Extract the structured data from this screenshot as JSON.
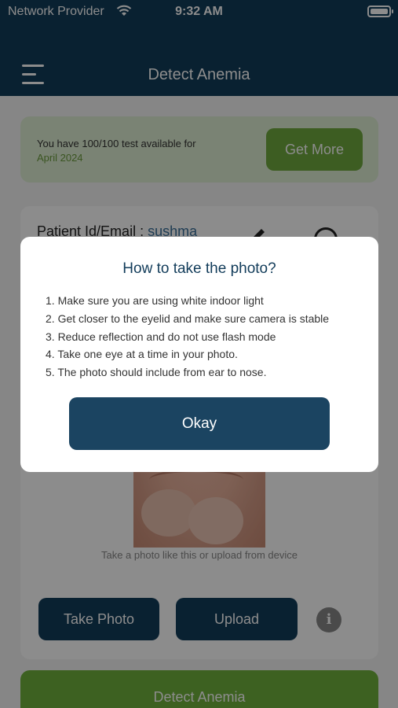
{
  "status_bar": {
    "carrier": "Network Provider",
    "time": "9:32 AM"
  },
  "header": {
    "title": "Detect Anemia"
  },
  "test_card": {
    "message": "You have 100/100 test available for",
    "date": "April 2024",
    "button_label": "Get More"
  },
  "patient": {
    "label": "Patient Id/Email : ",
    "value": "sushma"
  },
  "photo_section": {
    "caption": "Take a photo like this or upload from device",
    "take_photo_label": "Take Photo",
    "upload_label": "Upload"
  },
  "detect_button_label": "Detect Anemia",
  "dialog": {
    "title": "How to take the photo?",
    "steps": [
      "1. Make sure you are using white indoor light",
      "2. Get closer to the eyelid and make sure camera is stable",
      "3. Reduce reflection and do not use flash mode",
      "4. Take one eye at a time in your photo.",
      "5. The photo should include from ear to nose."
    ],
    "okay_label": "Okay"
  },
  "colors": {
    "primary": "#123c5a",
    "accent_green": "#6fb13c",
    "overlay": "rgba(0,0,0,0.45)"
  }
}
